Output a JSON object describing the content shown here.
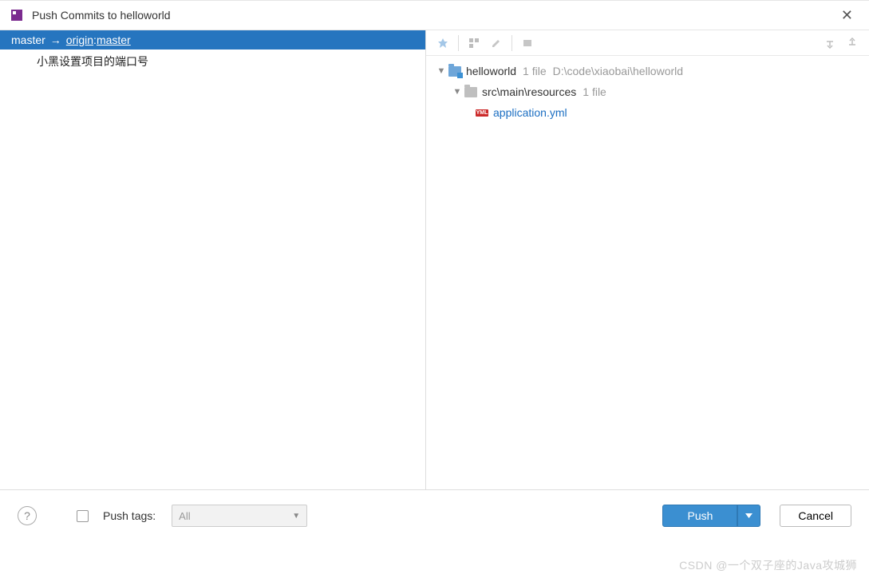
{
  "titlebar": {
    "title": "Push Commits to helloworld"
  },
  "left": {
    "branch_local": "master",
    "arrow": "→",
    "branch_remote_name": "origin",
    "colon": " : ",
    "branch_remote_branch": "master",
    "commits": [
      "小黑设置项目的端口号"
    ]
  },
  "tree": {
    "root": {
      "name": "helloworld",
      "meta_count": "1 file",
      "meta_path": "D:\\code\\xiaobai\\helloworld"
    },
    "folder": {
      "name": "src\\main\\resources",
      "meta_count": "1 file"
    },
    "file": {
      "name": "application.yml",
      "badge": "YML"
    }
  },
  "footer": {
    "help": "?",
    "push_tags_label": "Push tags:",
    "dropdown_value": "All",
    "push_label": "Push",
    "cancel_label": "Cancel"
  },
  "watermark": "CSDN @一个双子座的Java攻城狮"
}
